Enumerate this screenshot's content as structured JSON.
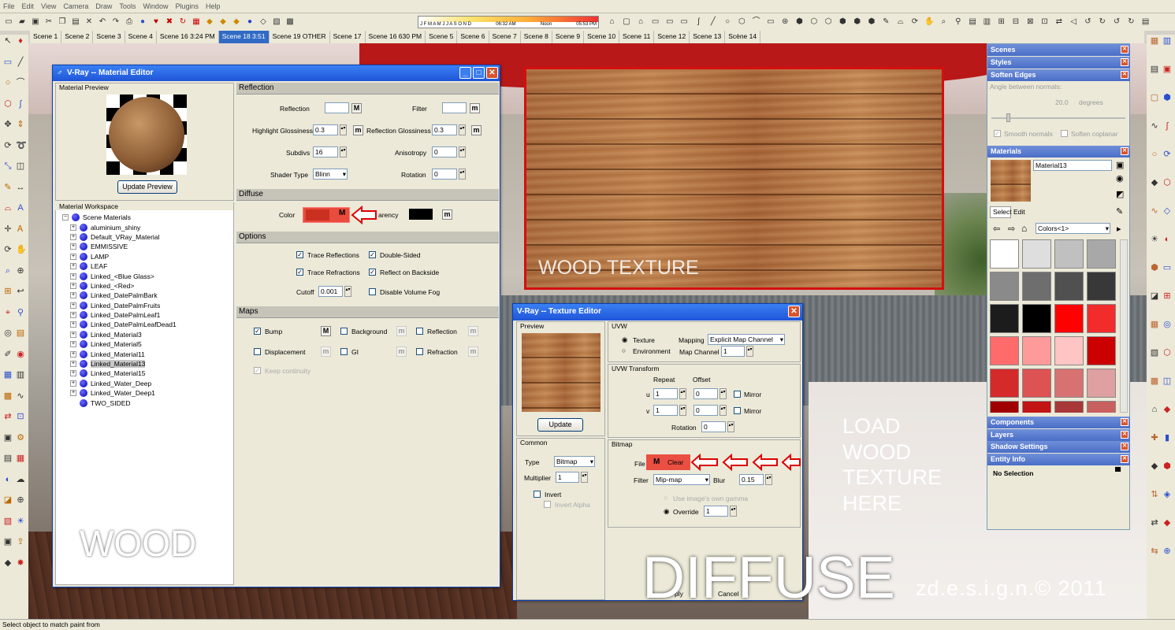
{
  "menu": [
    "File",
    "Edit",
    "View",
    "Camera",
    "Draw",
    "Tools",
    "Window",
    "Plugins",
    "Help"
  ],
  "timebar": {
    "months": "J F M A M J J A S O N D",
    "start": "06:32 AM",
    "noon": "Noon",
    "end": "05:53 PM"
  },
  "scene_tabs": [
    "Scene 1",
    "Scene 2",
    "Scene 3",
    "Scene 4",
    "Scene 16 3:24 PM",
    "Scene 18 3:51",
    "Scene 19 OTHER",
    "Scene 17",
    "Scene 16 630 PM",
    "Scene 5",
    "Scene 6",
    "Scene 7",
    "Scene 8",
    "Scene 9",
    "Scene 10",
    "Scene 11",
    "Scene 12",
    "Scene 13",
    "Scène 14"
  ],
  "status": "Select object to match paint from",
  "material_editor": {
    "title": "V-Ray -- Material Editor",
    "preview_label": "Material Preview",
    "update_preview": "Update Preview",
    "workspace_label": "Material Workspace",
    "root": "Scene Materials",
    "materials": [
      "aluminium_shiny",
      "Default_VRay_Material",
      "EMMISSIVE",
      "LAMP",
      "LEAF",
      "Linked_<Blue Glass>",
      "Linked_<Red>",
      "Linked_DatePalmBark",
      "Linked_DatePalmFruits",
      "Linked_DatePalmLeaf1",
      "Linked_DatePalmLeafDead1",
      "Linked_Material3",
      "Linked_Material5",
      "Linked_Material11",
      "Linked_Material13",
      "Linked_Material15",
      "Linked_Water_Deep",
      "Linked_Water_Deep1",
      "TWO_SIDED"
    ],
    "selected": "Linked_Material13",
    "reflection": {
      "header": "Reflection",
      "reflection": "Reflection",
      "filter": "Filter",
      "highlight_glossiness": "Highlight Glossiness",
      "highlight_val": "0.3",
      "reflection_glossiness": "Reflection Glossiness",
      "reflection_val": "0.3",
      "subdivs": "Subdivs",
      "subdivs_val": "16",
      "anisotropy": "Anisotropy",
      "anisotropy_val": "0",
      "shader_type": "Shader Type",
      "shader_val": "Blinn",
      "rotation": "Rotation",
      "rotation_val": "0"
    },
    "diffuse": {
      "header": "Diffuse",
      "color": "Color",
      "transparency": "arency"
    },
    "options": {
      "header": "Options",
      "trace_reflections": "Trace Reflections",
      "double_sided": "Double-Sided",
      "trace_refractions": "Trace Refractions",
      "reflect_backside": "Reflect on Backside",
      "cutoff": "Cutoff",
      "cutoff_val": "0.001",
      "disable_fog": "Disable Volume Fog"
    },
    "maps": {
      "header": "Maps",
      "bump": "Bump",
      "background": "Background",
      "reflection": "Reflection",
      "displacement": "Displacement",
      "gi": "GI",
      "refraction": "Refraction",
      "keep": "Keep continuity"
    }
  },
  "texture_editor": {
    "title": "V-Ray -- Texture Editor",
    "preview": "Preview",
    "update": "Update",
    "uvw": "UVW",
    "texture": "Texture",
    "environment": "Environment",
    "mapping": "Mapping",
    "mapping_val": "Explicit Map Channel",
    "map_channel": "Map Channel",
    "map_channel_val": "1",
    "transform": "UVW Transform",
    "repeat": "Repeat",
    "offset": "Offset",
    "u": "u",
    "v": "v",
    "u_repeat": "1",
    "v_repeat": "1",
    "u_offset": "0",
    "v_offset": "0",
    "mirror": "Mirror",
    "rotation": "Rotation",
    "rotation_val": "0",
    "common": "Common",
    "type": "Type",
    "type_val": "Bitmap",
    "multiplier": "Multiplier",
    "multiplier_val": "1",
    "invert": "Invert",
    "invert_alpha": "Invert Alpha",
    "bitmap": "Bitmap",
    "file": "File",
    "clear": "Clear",
    "filter": "Filter",
    "filter_val": "Mip-map",
    "blur": "Blur",
    "blur_val": "0.15",
    "use_gamma": "Use image's own gamma",
    "override": "Override",
    "override_val": "1",
    "apply": "ply",
    "cancel": "Cancel"
  },
  "trays": {
    "scenes": "Scenes",
    "styles": "Styles",
    "soften": "Soften Edges",
    "angle": "Angle between normals:",
    "angle_val": "20.0",
    "degrees": "degrees",
    "smooth": "Smooth normals",
    "coplanar": "Soften coplanar",
    "materials": "Materials",
    "material_name": "Material13",
    "select": "Select",
    "edit": "Edit",
    "colors": "Colors<1>",
    "components": "Components",
    "layers": "Layers",
    "shadow": "Shadow Settings",
    "entity": "Entity Info",
    "no_selection": "No Selection"
  },
  "swatches": [
    "#ffffff",
    "#dedede",
    "#c0c0c0",
    "#a8a8a8",
    "#8a8a8a",
    "#6e6e6e",
    "#505050",
    "#383838",
    "#1c1c1c",
    "#000000",
    "#ff0000",
    "#f22b2b",
    "#ff6b6b",
    "#ff9a9a",
    "#ffc4c4",
    "#cc0000",
    "#d42a2a",
    "#dd5252",
    "#d87272",
    "#dea0a0",
    "#a00000",
    "#c21414",
    "#a83838",
    "#c86060"
  ],
  "overlay": {
    "wood_texture": "WOOD TEXTURE",
    "load": [
      "LOAD",
      "WOOD",
      "TEXTURE",
      "HERE"
    ],
    "wood": "WOOD",
    "diffuse": "DIFFUSE",
    "credit": "zd.e.s.i.g.n.© 2011"
  }
}
